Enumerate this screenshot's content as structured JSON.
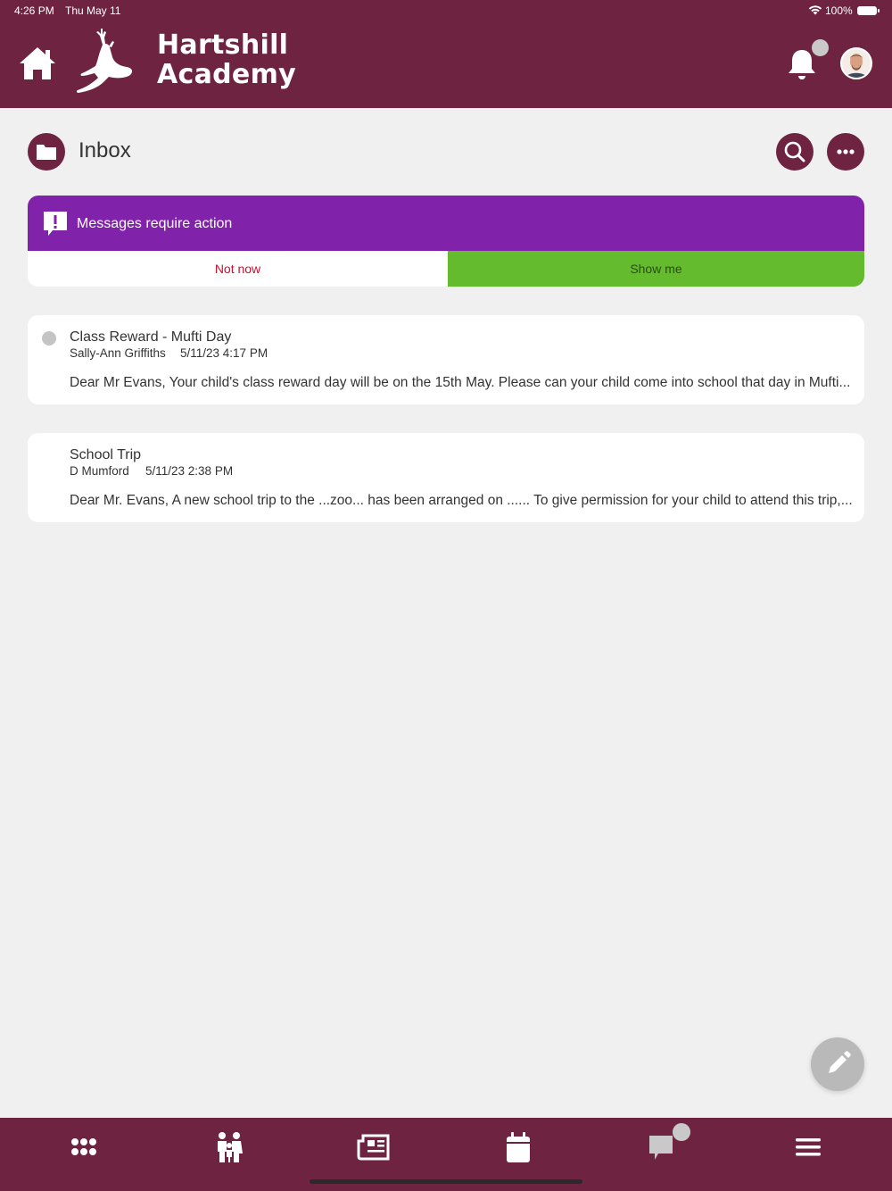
{
  "status_bar": {
    "time": "4:26 PM",
    "date": "Thu May 11",
    "battery_percent": "100%"
  },
  "header": {
    "school_name_line1": "Hartshill",
    "school_name_line2": "Academy",
    "icons": [
      "home-icon",
      "stag-logo",
      "bell-icon",
      "avatar"
    ],
    "brand_color": "#6e2440"
  },
  "inbox": {
    "title": "Inbox"
  },
  "action_banner": {
    "text": "Messages require action",
    "not_now_label": "Not now",
    "show_me_label": "Show me",
    "banner_color": "#8122ab",
    "show_me_color": "#64bb2d",
    "not_now_color": "#c8102e"
  },
  "messages": [
    {
      "subject": "Class Reward - Mufti Day",
      "sender": "Sally-Ann Griffiths",
      "datetime": "5/11/23 4:17 PM",
      "preview": "Dear Mr Evans, Your child's class reward day will be on the 15th May. Please can your child come into school that day in Mufti...",
      "unread": true
    },
    {
      "subject": "School Trip",
      "sender": "D Mumford",
      "datetime": "5/11/23 2:38 PM",
      "preview": "Dear Mr. Evans, A new school trip to the ...zoo... has been arranged on ...... To give permission for your child to attend this trip,...",
      "unread": false
    }
  ],
  "bottom_nav": {
    "icons": [
      "apps-grid-icon",
      "family-icon",
      "news-icon",
      "calendar-icon",
      "chat-icon",
      "menu-icon"
    ]
  }
}
